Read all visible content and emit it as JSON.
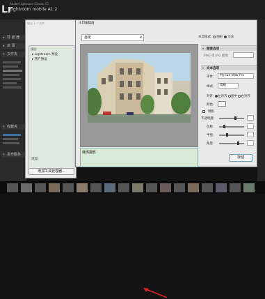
{
  "lightroom": {
    "catalog": "Adobe Lightroom Classic CC",
    "app_name": "Lightroom mobile A1.2",
    "logo": "Lr",
    "left_panels": [
      "导 航 器",
      "目 录",
      "文件夹",
      "收藏夹",
      "发布服务"
    ]
  },
  "preset_dialog": {
    "title": "输出 1 个文件",
    "list_header": "预设:",
    "items": [
      "Lightroom 预设",
      "用户预设"
    ],
    "tab_label": "添加",
    "manage_button": "增加工具管理器..."
  },
  "editor": {
    "title": "水印编辑器",
    "preset": "自定",
    "watermark_text": "韩涛摄影",
    "watermark_type_label": "水印样式:",
    "type_text": "文本",
    "type_graphic": "图形",
    "image_section": "图像选项",
    "image_hint": "PNG 或 JPG 图像",
    "text_section": "文本选项",
    "font_label": "字体:",
    "font_value": "Myriad Web Pro",
    "style_label": "样式:",
    "style_value": "常规",
    "align_label": "对齐:",
    "align_options": [
      "左对齐",
      "居中",
      "右对齐"
    ],
    "color_label": "颜色:",
    "shadow_label": "阴影",
    "opacity_label": "不透明度:",
    "offset_label": "位移:",
    "radius_label": "半径:",
    "angle_label": "角度:",
    "save_button": "存储"
  }
}
